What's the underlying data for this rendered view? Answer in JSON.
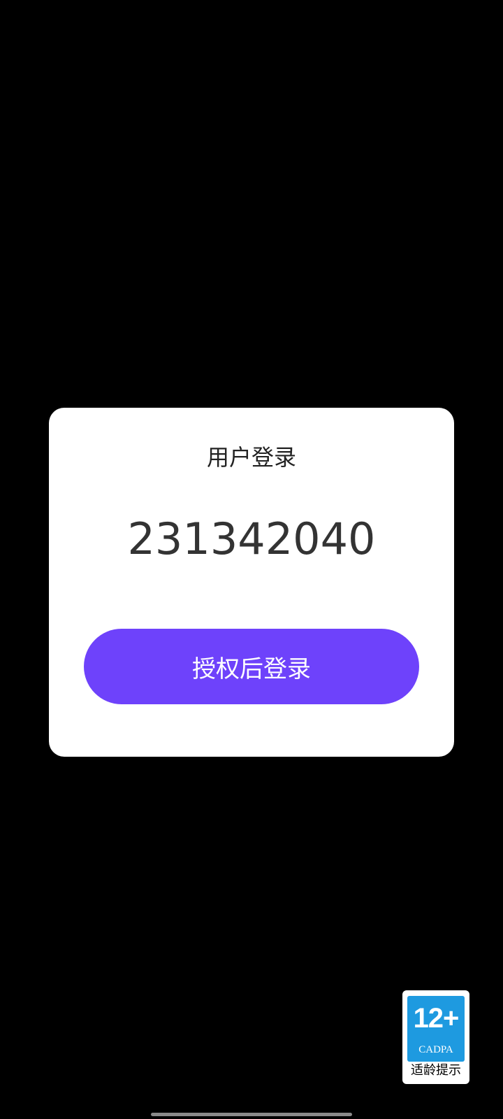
{
  "dialog": {
    "title": "用户登录",
    "user_id": "231342040",
    "authorize_button_label": "授权后登录"
  },
  "age_badge": {
    "rating": "12+",
    "org": "CADPA",
    "label": "适龄提示"
  },
  "colors": {
    "background": "#000000",
    "dialog": "#ffffff",
    "accent": "#6e42fb",
    "badge_blue": "#1e9ae0"
  }
}
